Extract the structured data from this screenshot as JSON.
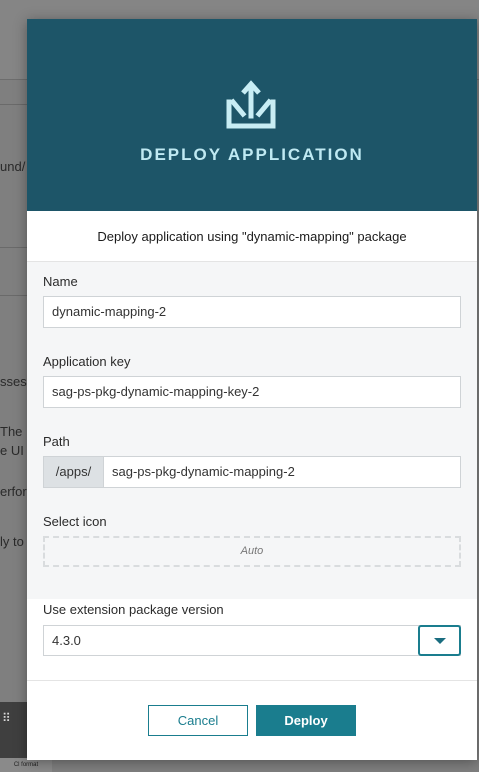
{
  "background": {
    "snippets": [
      "und/",
      "sses",
      "The",
      "e UI t",
      "erfor",
      "ly to"
    ],
    "tab_label": "Cl format"
  },
  "modal": {
    "title": "DEPLOY APPLICATION",
    "header_icon": "deploy-upload-icon",
    "subtitle": "Deploy application using \"dynamic-mapping\" package",
    "fields": {
      "name": {
        "label": "Name",
        "value": "dynamic-mapping-2"
      },
      "app_key": {
        "label": "Application key",
        "value": "sag-ps-pkg-dynamic-mapping-key-2"
      },
      "path": {
        "label": "Path",
        "prefix": "/apps/",
        "value": "sag-ps-pkg-dynamic-mapping-2"
      },
      "icon": {
        "label": "Select icon",
        "value": "Auto"
      },
      "version": {
        "label": "Use extension package version",
        "value": "4.3.0"
      }
    },
    "buttons": {
      "cancel": "Cancel",
      "deploy": "Deploy"
    }
  },
  "colors": {
    "header_bg": "#1d5568",
    "title": "#bfe9f2",
    "accent": "#1a7d8e"
  }
}
